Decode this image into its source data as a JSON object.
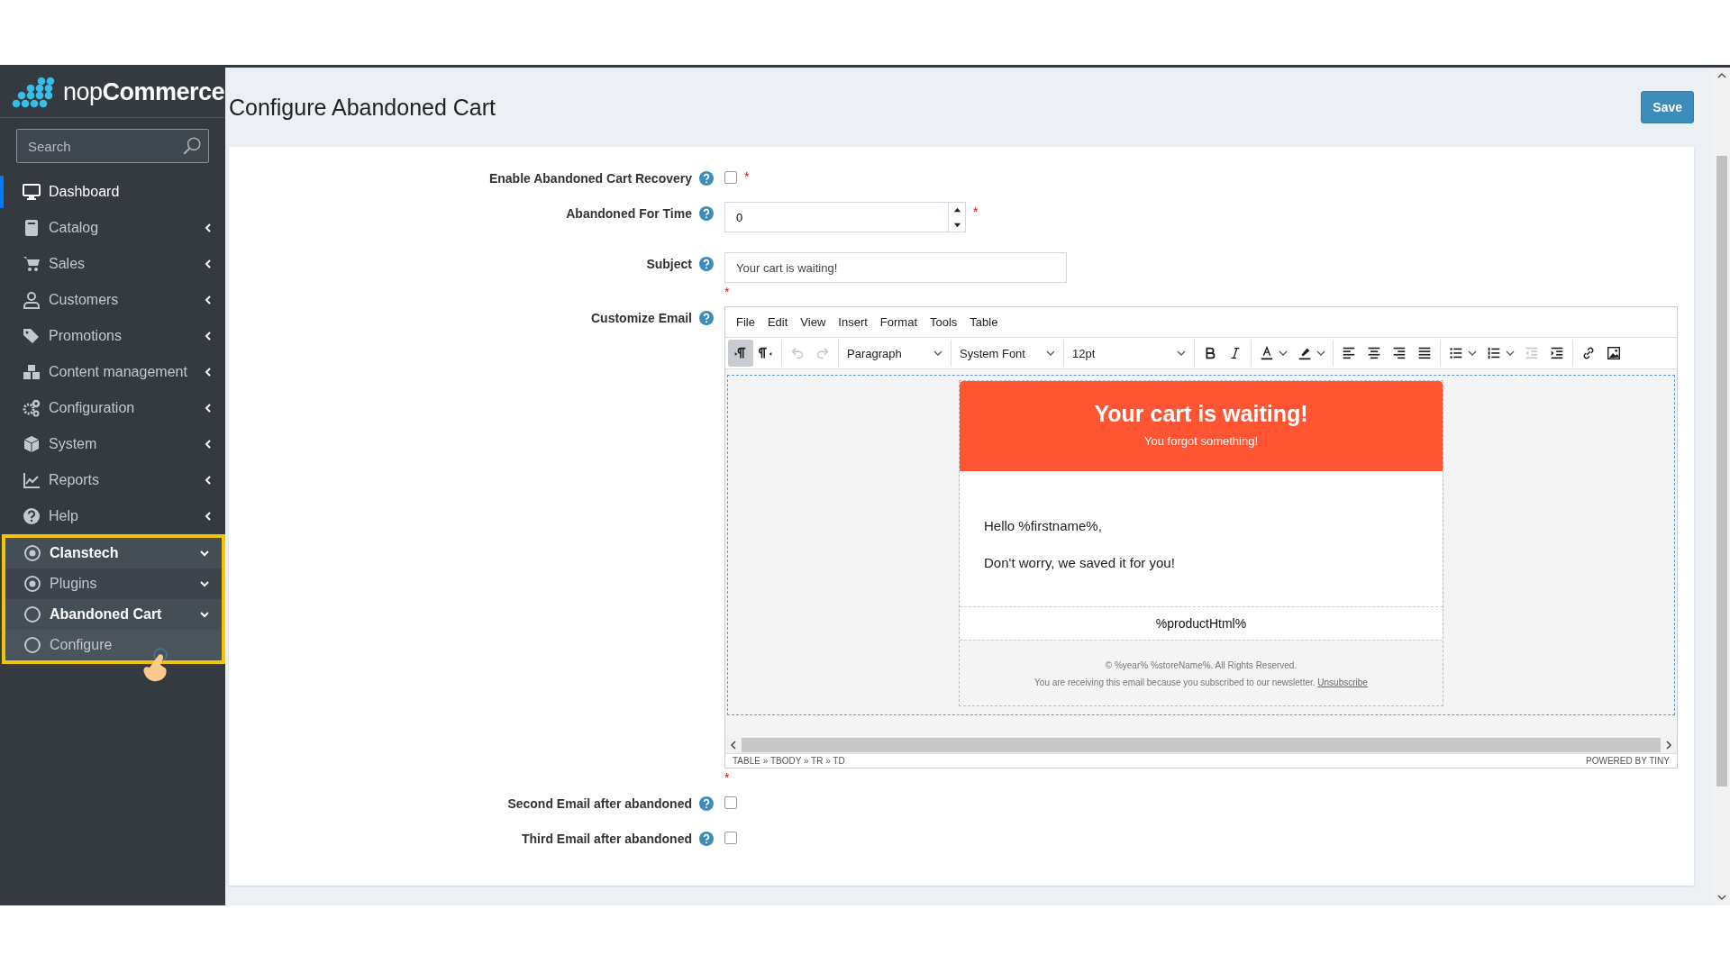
{
  "brand": {
    "name": "nop**Commerce**"
  },
  "search": {
    "placeholder": "Search"
  },
  "sidebar": {
    "items": [
      {
        "label": "Dashboard",
        "selected": true
      },
      {
        "label": "Catalog",
        "selected": false,
        "expanded": false
      },
      {
        "label": "Sales",
        "selected": false,
        "expanded": false
      },
      {
        "label": "Customers",
        "selected": false,
        "expanded": false
      },
      {
        "label": "Promotions",
        "selected": false,
        "expanded": false
      },
      {
        "label": "Content management",
        "selected": false,
        "expanded": false
      },
      {
        "label": "Configuration",
        "selected": false,
        "expanded": false
      },
      {
        "label": "System",
        "selected": false,
        "expanded": false
      },
      {
        "label": "Reports",
        "selected": false,
        "expanded": false
      },
      {
        "label": "Help",
        "selected": false,
        "expanded": false
      },
      {
        "label": "Clanstech",
        "selected": false,
        "current": true,
        "expanded": true,
        "highlighted": true,
        "children": [
          {
            "label": "Plugins",
            "selected": false,
            "current": false,
            "expanded": true,
            "children": [
              {
                "label": "Abandoned Cart",
                "selected": false,
                "current": true,
                "expanded": true,
                "children": [
                  {
                    "label": "Configure",
                    "selected": false
                  }
                ]
              }
            ]
          }
        ]
      }
    ]
  },
  "page": {
    "title": "Configure Abandoned Cart",
    "save_button": "Save"
  },
  "form": [
    {
      "kind": "checkbox",
      "label": "Enable Abandoned Cart Recovery",
      "checked": false,
      "required_mark": "*"
    },
    {
      "kind": "number",
      "label": "Abandoned For Time",
      "value": "0",
      "required_mark": "*"
    },
    {
      "kind": "text",
      "label": "Subject",
      "value": "Your cart is waiting!",
      "required_mark": "*"
    },
    {
      "kind": "editor",
      "label": "Customize Email",
      "required_mark": "*"
    },
    {
      "kind": "checkbox",
      "label": "Second Email after abandoned",
      "checked": false
    },
    {
      "kind": "checkbox",
      "label": "Third Email after abandoned",
      "checked": false
    }
  ],
  "editor": {
    "menu": [
      "File",
      "Edit",
      "View",
      "Insert",
      "Format",
      "Tools",
      "Table"
    ],
    "toolbar": [
      [
        {
          "kind": "ltr",
          "pressed": true,
          "disabled": false
        },
        {
          "kind": "rtl",
          "pressed": false,
          "disabled": false
        }
      ],
      [
        {
          "kind": "undo",
          "pressed": false,
          "disabled": true
        },
        {
          "kind": "redo",
          "pressed": false,
          "disabled": true
        }
      ],
      [
        {
          "kind": "select",
          "value": "Paragraph"
        }
      ],
      [
        {
          "kind": "select",
          "value": "System Font"
        }
      ],
      [
        {
          "kind": "select",
          "value": "12pt"
        }
      ],
      [
        {
          "kind": "bold",
          "pressed": false,
          "disabled": false
        },
        {
          "kind": "italic",
          "pressed": false,
          "disabled": false
        }
      ],
      [
        {
          "kind": "textcolor",
          "pressed": false,
          "disabled": false
        },
        {
          "kind": "highlight",
          "pressed": false,
          "disabled": false
        }
      ],
      [
        {
          "kind": "alignleft",
          "pressed": false,
          "disabled": false
        },
        {
          "kind": "aligncenter",
          "pressed": false,
          "disabled": false
        },
        {
          "kind": "alignright",
          "pressed": false,
          "disabled": false
        },
        {
          "kind": "justify",
          "pressed": false,
          "disabled": false
        }
      ],
      [
        {
          "kind": "bullist",
          "pressed": false,
          "disabled": false
        },
        {
          "kind": "numlist",
          "pressed": false,
          "disabled": false
        },
        {
          "kind": "outdent",
          "pressed": false,
          "disabled": true
        },
        {
          "kind": "indent",
          "pressed": false,
          "disabled": false
        }
      ],
      [
        {
          "kind": "link",
          "pressed": false,
          "disabled": false
        },
        {
          "kind": "image",
          "pressed": false,
          "disabled": false
        }
      ]
    ],
    "email": {
      "title": "Your cart is waiting!",
      "subtitle": "You forgot something!",
      "greeting": "Hello %firstname%,",
      "body": "Don't worry, we saved it for you!",
      "products": "%productHtml%",
      "copyright": "© %year% %storeName%. All Rights Reserved.",
      "notice": "You are receiving this email because you subscribed to our newsletter.",
      "unsubscribe": "Unsubscribe"
    },
    "path": "TABLE » TBODY » TR » TD",
    "branding": "POWERED BY TINY"
  }
}
